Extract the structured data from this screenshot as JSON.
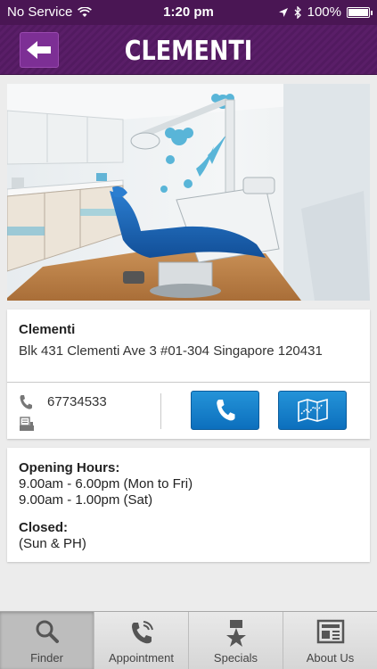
{
  "status_bar": {
    "carrier": "No Service",
    "time": "1:20 pm",
    "battery": "100%"
  },
  "nav": {
    "title": "CLEMENTI"
  },
  "clinic": {
    "name": "Clementi",
    "address": "Blk 431 Clementi Ave 3  #01-304 Singapore 120431",
    "phone": "67734533"
  },
  "hours": {
    "opening_label": "Opening Hours:",
    "weekday": "9.00am - 6.00pm (Mon to Fri)",
    "saturday": "9.00am - 1.00pm (Sat)",
    "closed_label": "Closed:",
    "closed_days": "(Sun & PH)"
  },
  "tabs": [
    {
      "label": "Finder",
      "icon": "search-icon",
      "active": true
    },
    {
      "label": "Appointment",
      "icon": "phone-ringing-icon",
      "active": false
    },
    {
      "label": "Specials",
      "icon": "star-ribbon-icon",
      "active": false
    },
    {
      "label": "About Us",
      "icon": "news-icon",
      "active": false
    }
  ],
  "colors": {
    "header": "#5a1e68",
    "accent_button": "#1a82cc"
  }
}
